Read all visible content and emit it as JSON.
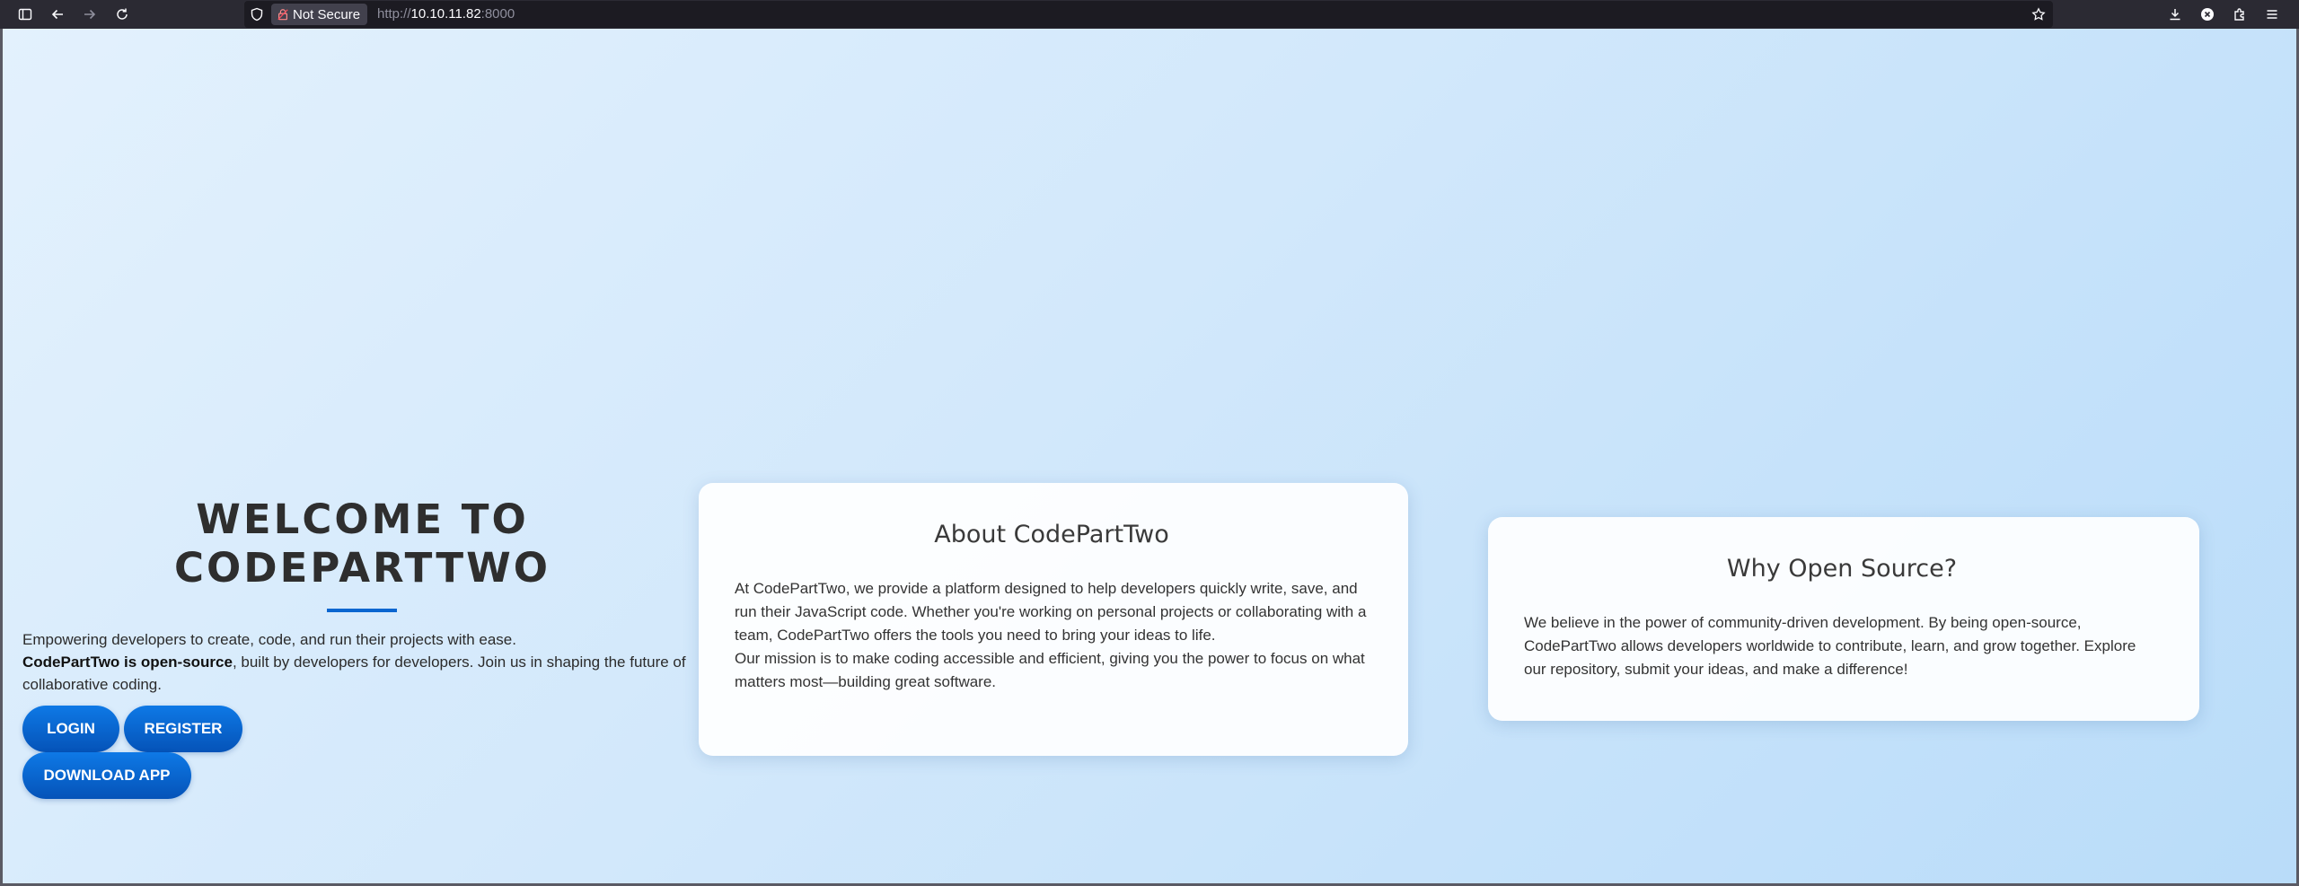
{
  "browser": {
    "security_label": "Not Secure",
    "url_scheme": "http://",
    "url_host": "10.10.11.82",
    "url_port": ":8000",
    "icons": [
      "sidebar-icon",
      "back-icon",
      "forward-icon",
      "reload-icon",
      "shield-icon",
      "lock-warning-icon",
      "star-icon",
      "download-icon",
      "extension-icon",
      "puzzle-icon",
      "menu-icon"
    ]
  },
  "hero": {
    "title": "WELCOME TO CODEPARTTWO",
    "line1": "Empowering developers to create, code, and run their projects with ease.",
    "line2_bold": "CodePartTwo is open-source",
    "line2_rest": ", built by developers for developers. Join us in shaping the future of collaborative coding.",
    "login_label": "LOGIN",
    "register_label": "REGISTER",
    "download_label": "DOWNLOAD APP"
  },
  "about": {
    "title": "About CodePartTwo",
    "paragraph1": "At CodePartTwo, we provide a platform designed to help developers quickly write, save, and run their JavaScript code. Whether you're working on personal projects or collaborating with a team, CodePartTwo offers the tools you need to bring your ideas to life.",
    "paragraph2": "Our mission is to make coding accessible and efficient, giving you the power to focus on what matters most—building great software."
  },
  "why": {
    "title": "Why Open Source?",
    "paragraph": "We believe in the power of community-driven development. By being open-source, CodePartTwo allows developers worldwide to contribute, learn, and grow together. Explore our repository, submit your ideas, and make a difference!"
  },
  "colors": {
    "accent": "#0a66d0",
    "button": "#0661c8",
    "background": "#d2e8fb"
  }
}
